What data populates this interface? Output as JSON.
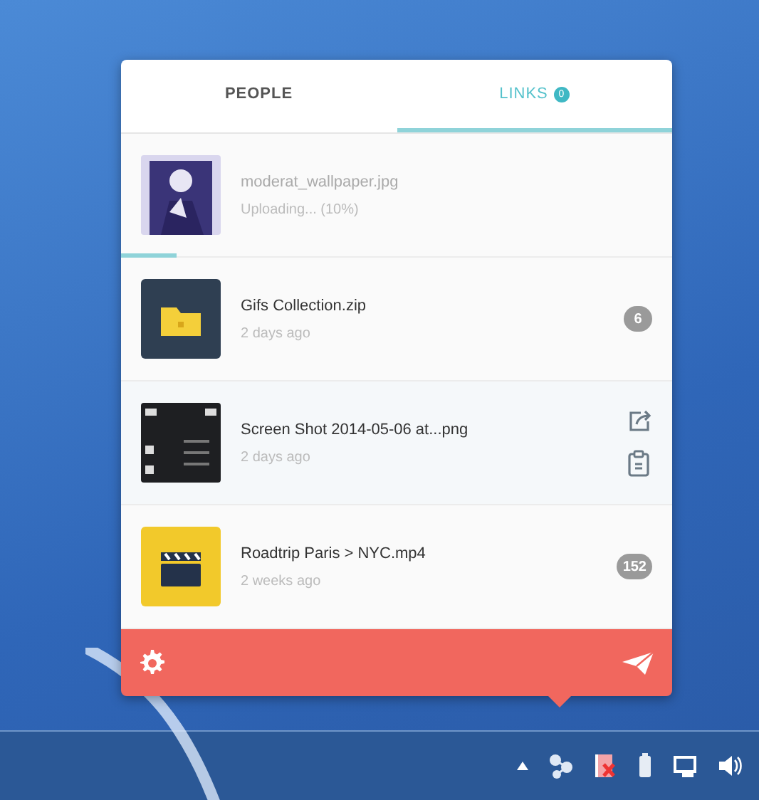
{
  "tabs": [
    {
      "label": "PEOPLE",
      "selected": false
    },
    {
      "label": "LINKS",
      "selected": true,
      "badge": "0"
    }
  ],
  "items": [
    {
      "kind": "upload",
      "name": "moderat_wallpaper.jpg",
      "status": "Uploading... (10%)",
      "level": 0.1
    },
    {
      "kind": "archive",
      "name": "Gifs Collection.zip",
      "time": "2 days ago",
      "count": "6",
      "hovered": false
    },
    {
      "kind": "image",
      "name": "Screen Shot 2014-05-06 at...png",
      "time": "2 days ago",
      "hovered": true
    },
    {
      "kind": "video",
      "name": "Roadtrip Paris > NYC.mp4",
      "time": "2 weeks ago",
      "count": "152",
      "hovered": false
    }
  ]
}
